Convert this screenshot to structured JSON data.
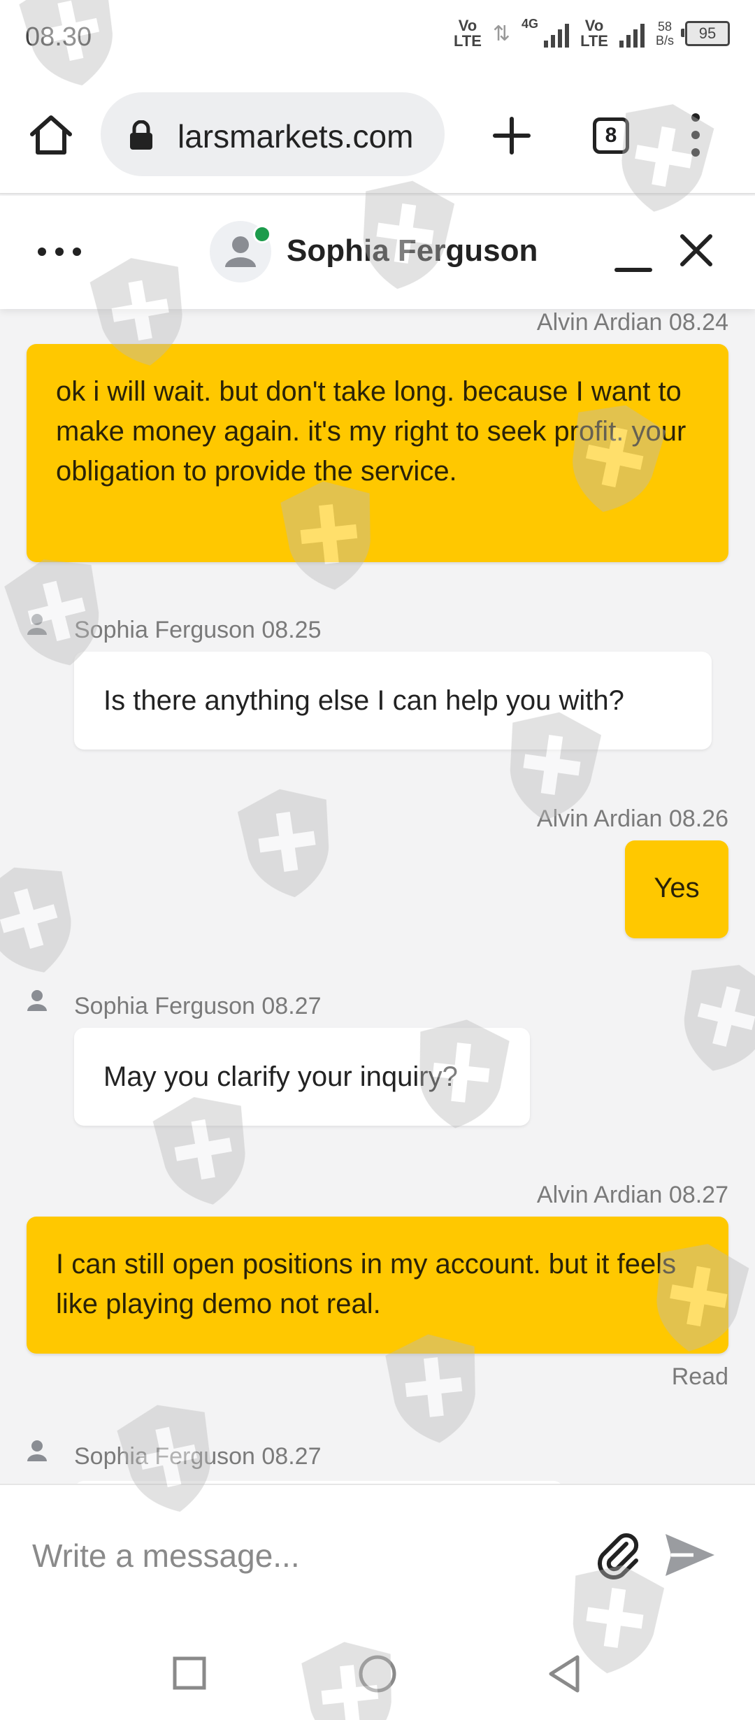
{
  "status_bar": {
    "time": "08.30",
    "volte_top": "Vo",
    "volte_bottom": "LTE",
    "network": "4G",
    "speed_value": "58",
    "speed_unit": "B/s",
    "battery": "95"
  },
  "browser": {
    "url": "larsmarkets.com",
    "tab_count": "8"
  },
  "chat_header": {
    "agent_name": "Sophia Ferguson",
    "online": true,
    "online_color": "#1c9b4c"
  },
  "messages": [
    {
      "sender": "Alvin Ardian 08.24",
      "from": "user",
      "text": "ok i will wait. but don't take long. because I want to make money again. it's my right to seek profit. your obligation to provide the service."
    },
    {
      "sender": "Sophia Ferguson 08.25",
      "from": "agent",
      "text": "Is there anything else I can help you with?"
    },
    {
      "sender": "Alvin Ardian 08.26",
      "from": "user",
      "text": "Yes"
    },
    {
      "sender": "Sophia Ferguson 08.27",
      "from": "agent",
      "text": "May you clarify your inquiry?"
    },
    {
      "sender": "Alvin Ardian 08.27",
      "from": "user",
      "text": "I can still open positions in my account. but it feels like playing demo not real.",
      "status": "Read"
    },
    {
      "sender": "Sophia Ferguson 08.27",
      "from": "agent",
      "text": ""
    }
  ],
  "composer": {
    "placeholder": "Write a message..."
  },
  "colors": {
    "user_bubble": "#ffc800",
    "agent_bubble": "#ffffff",
    "background": "#f3f3f4"
  },
  "icons": [
    "home-icon",
    "lock-icon",
    "plus-icon",
    "tabs-icon",
    "more-vert-icon",
    "more-horiz-icon",
    "person-icon",
    "minimize-icon",
    "close-icon",
    "attach-icon",
    "send-icon",
    "recents-icon",
    "nav-home-icon",
    "back-icon",
    "shield-watermark"
  ]
}
